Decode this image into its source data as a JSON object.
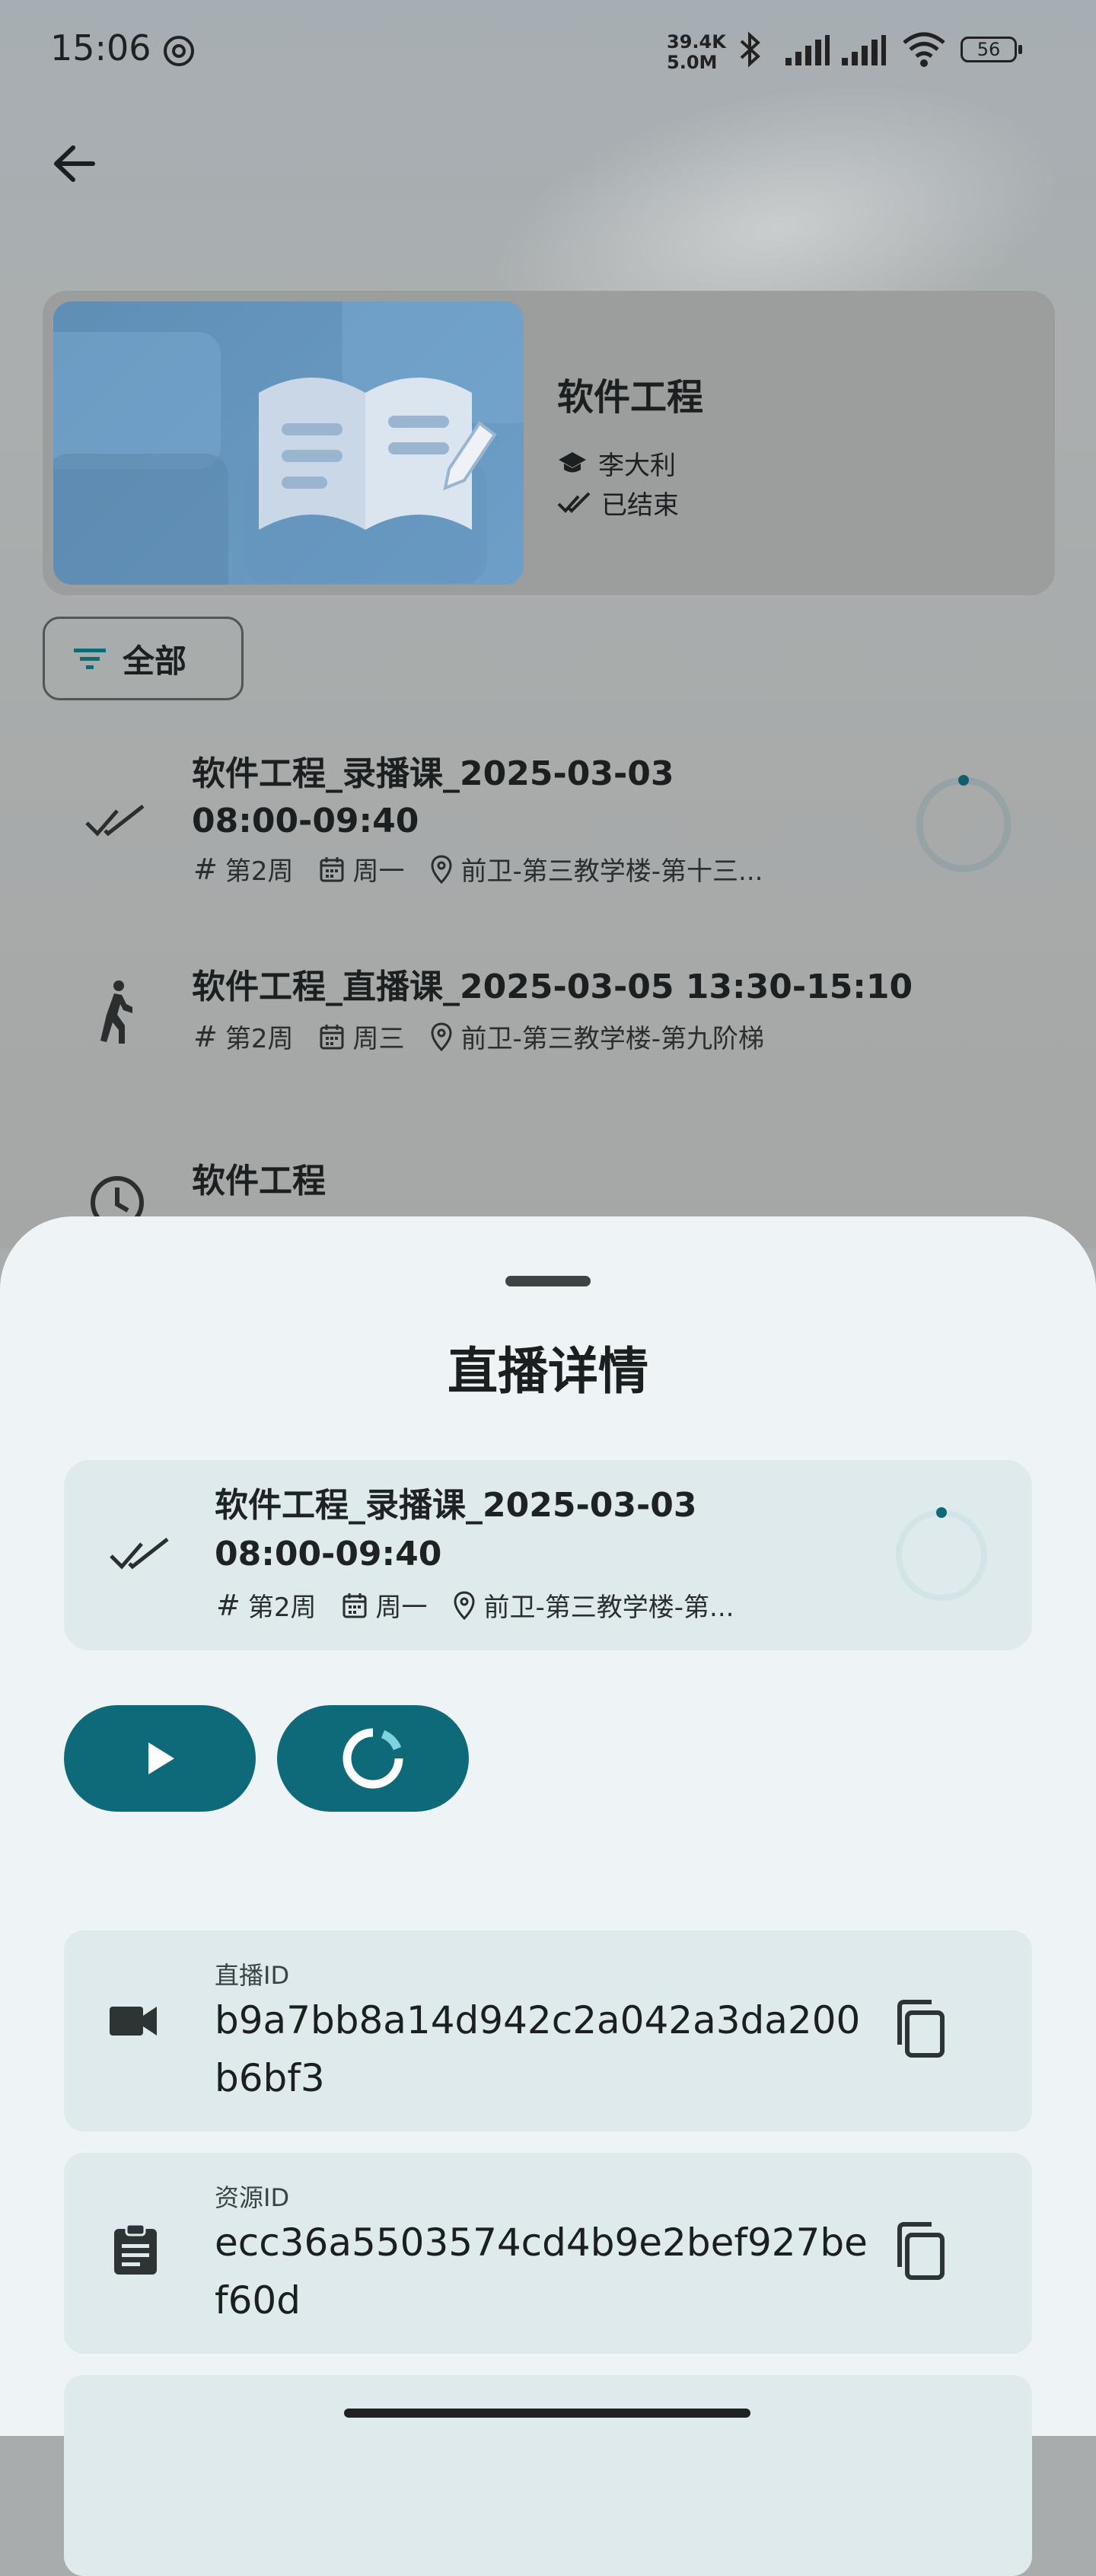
{
  "status_bar": {
    "time": "15:06",
    "net_up": "39.4K",
    "net_down": "5.0M",
    "battery": "56"
  },
  "course": {
    "title": "软件工程",
    "teacher": "李大利",
    "state": "已结束"
  },
  "filter": {
    "label": "全部"
  },
  "list": [
    {
      "title_line1": "软件工程_录播课_2025-03-03",
      "title_line2": "08:00-09:40",
      "week": "第2周",
      "weekday": "周一",
      "location": "前卫-第三教学楼-第十三...",
      "status_icon": "done-all-icon"
    },
    {
      "title_line1": "软件工程_直播课_2025-03-05 13:30-15:10",
      "week": "第2周",
      "weekday": "周三",
      "location": "前卫-第三教学楼-第九阶梯",
      "status_icon": "walking-icon"
    },
    {
      "title_line1": "软件工程",
      "status_icon": "clock-icon"
    }
  ],
  "sheet": {
    "title": "直播详情",
    "item": {
      "title_line1": "软件工程_录播课_2025-03-03",
      "title_line2": "08:00-09:40",
      "week": "第2周",
      "weekday": "周一",
      "location": "前卫-第三教学楼-第..."
    },
    "live_id_label": "直播ID",
    "live_id": "b9a7bb8a14d942c2a042a3da200b6bf3",
    "resource_id_label": "资源ID",
    "resource_id": "ecc36a5503574cd4b9e2bef927bef60d"
  },
  "colors": {
    "accent": "#0e6a78",
    "sheet_bg": "#eef3f6",
    "card_bg": "#dfeaec"
  }
}
